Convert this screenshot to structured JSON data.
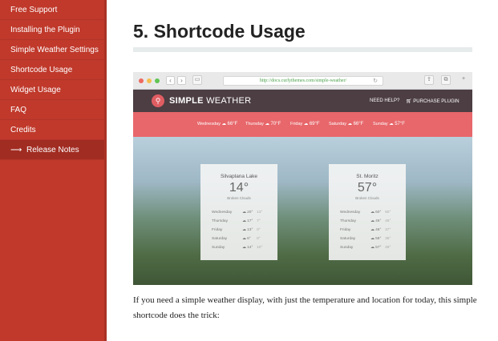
{
  "sidebar": {
    "items": [
      {
        "label": "Free Support"
      },
      {
        "label": "Installing the Plugin"
      },
      {
        "label": "Simple Weather Settings"
      },
      {
        "label": "Shortcode Usage"
      },
      {
        "label": "Widget Usage"
      },
      {
        "label": "FAQ"
      },
      {
        "label": "Credits"
      },
      {
        "label": "Release Notes",
        "arrow": "⟶",
        "active": true
      }
    ]
  },
  "main": {
    "heading": "5. Shortcode Usage",
    "paragraph": "If you need a simple weather display, with just the temperature and location for today, this simple shortcode does the trick:"
  },
  "screenshot": {
    "url": "http://docs.curlythemes.com/simple-weather/",
    "logo_text_bold": "SIMPLE",
    "logo_text": "WEATHER",
    "help_link": "NEED HELP?",
    "purchase_link": "PURCHASE PLUGIN",
    "forecast": [
      {
        "day": "Wednesday",
        "temp": "66°F"
      },
      {
        "day": "Thursday",
        "temp": "70°F"
      },
      {
        "day": "Friday",
        "temp": "69°F"
      },
      {
        "day": "Saturday",
        "temp": "66°F"
      },
      {
        "day": "Sunday",
        "temp": "57°F"
      }
    ],
    "cards": [
      {
        "city": "Silvaplana Lake",
        "temp": "14°",
        "cond": "Broken Clouds",
        "rows": [
          {
            "day": "Wednesday",
            "hi": "20°",
            "lo": "13°"
          },
          {
            "day": "Thursday",
            "hi": "17°",
            "lo": "7°"
          },
          {
            "day": "Friday",
            "hi": "13°",
            "lo": "0°"
          },
          {
            "day": "Saturday",
            "hi": "6°",
            "lo": "0°"
          },
          {
            "day": "Sunday",
            "hi": "14°",
            "lo": "10°"
          }
        ]
      },
      {
        "city": "St. Moritz",
        "temp": "57°",
        "cond": "Broken Clouds",
        "rows": [
          {
            "day": "Wednesday",
            "hi": "60°",
            "lo": "50°"
          },
          {
            "day": "Thursday",
            "hi": "46°",
            "lo": "45°"
          },
          {
            "day": "Friday",
            "hi": "46°",
            "lo": "37°"
          },
          {
            "day": "Saturday",
            "hi": "58°",
            "lo": "35°"
          },
          {
            "day": "Sunday",
            "hi": "57°",
            "lo": "49°"
          }
        ]
      }
    ]
  },
  "colors": {
    "sidebar": "#c0392b",
    "forecast_bar": "#e7676b",
    "site_header": "#4c3e43"
  }
}
